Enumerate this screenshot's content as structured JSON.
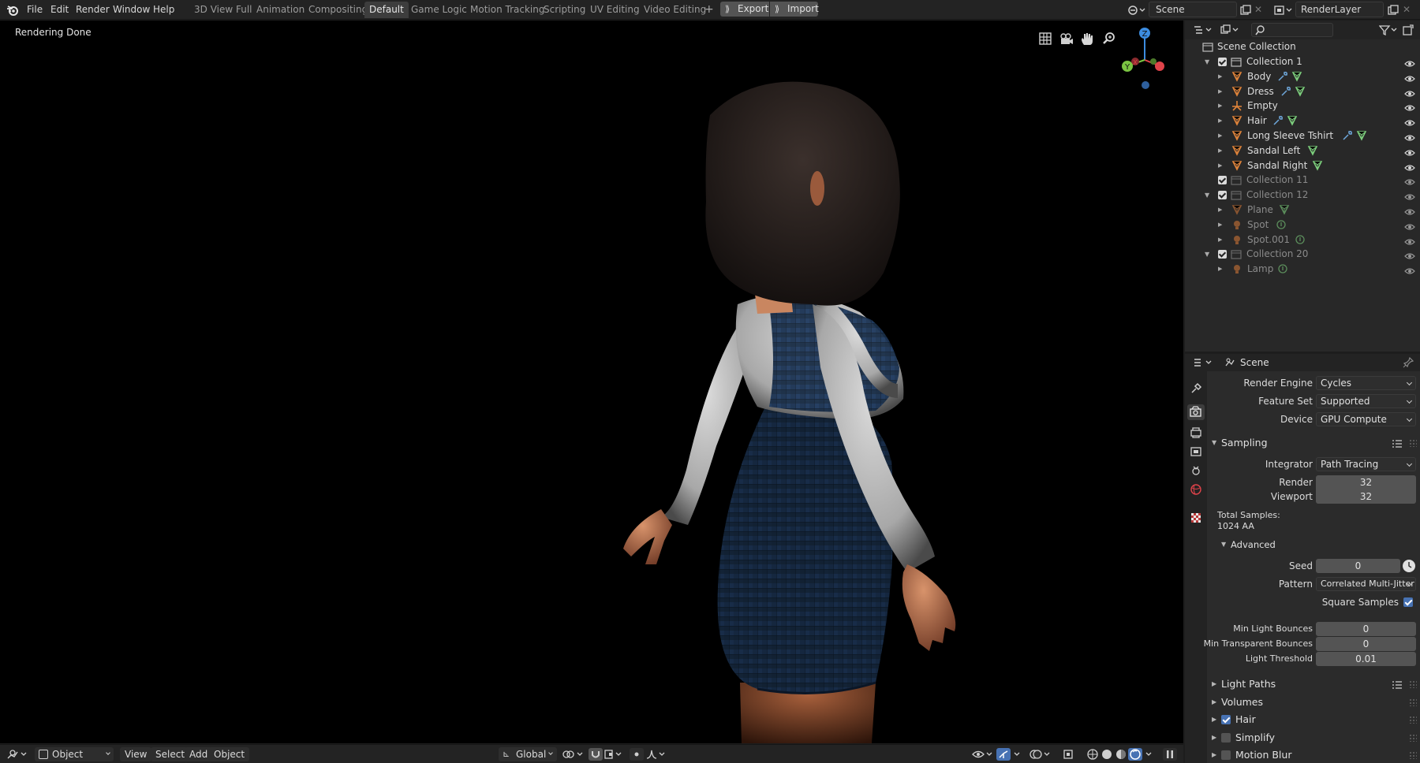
{
  "topbar": {
    "menus": [
      "File",
      "Edit",
      "Render",
      "Window",
      "Help"
    ],
    "workspaces": [
      "3D View Full",
      "Animation",
      "Compositing",
      "Default",
      "Game Logic",
      "Motion Tracking",
      "Scripting",
      "UV Editing",
      "Video Editing"
    ],
    "active_workspace": "Default",
    "add_tab": "+",
    "export_label": "Export",
    "import_label": "Import",
    "scene_name": "Scene",
    "render_layer": "RenderLayer"
  },
  "viewport": {
    "status": "Rendering Done",
    "gizmo": {
      "x": "X",
      "y": "Y",
      "z": "Z"
    }
  },
  "bottombar": {
    "mode": "Object Mode",
    "menus": [
      "View",
      "Select",
      "Add",
      "Object"
    ],
    "orientation": "Global"
  },
  "outliner": {
    "root": "Scene Collection",
    "rows": [
      {
        "label": "Collection 1",
        "level": 1,
        "kind": "collection",
        "dim": false,
        "expanded": true
      },
      {
        "label": "Body",
        "level": 2,
        "kind": "mesh",
        "dim": false,
        "icons": [
          "wrench",
          "mesh"
        ]
      },
      {
        "label": "Dress",
        "level": 2,
        "kind": "mesh",
        "dim": false,
        "icons": [
          "wrench",
          "mesh"
        ]
      },
      {
        "label": "Empty",
        "level": 2,
        "kind": "empty",
        "dim": false,
        "icons": []
      },
      {
        "label": "Hair",
        "level": 2,
        "kind": "mesh",
        "dim": false,
        "icons": [
          "wrench",
          "mesh"
        ]
      },
      {
        "label": "Long Sleeve Tshirt",
        "level": 2,
        "kind": "mesh",
        "dim": false,
        "icons": [
          "wrench",
          "mesh"
        ]
      },
      {
        "label": "Sandal Left",
        "level": 2,
        "kind": "mesh",
        "dim": false,
        "icons": [
          "mesh"
        ]
      },
      {
        "label": "Sandal Right",
        "level": 2,
        "kind": "mesh",
        "dim": false,
        "icons": [
          "mesh"
        ]
      },
      {
        "label": "Collection 11",
        "level": 1,
        "kind": "collection",
        "dim": true,
        "expanded": false
      },
      {
        "label": "Collection 12",
        "level": 1,
        "kind": "collection",
        "dim": true,
        "expanded": true
      },
      {
        "label": "Plane",
        "level": 2,
        "kind": "mesh",
        "dim": true,
        "icons": [
          "mesh"
        ]
      },
      {
        "label": "Spot",
        "level": 2,
        "kind": "light",
        "dim": true,
        "icons": [
          "light-data"
        ]
      },
      {
        "label": "Spot.001",
        "level": 2,
        "kind": "light",
        "dim": true,
        "icons": [
          "light-data"
        ]
      },
      {
        "label": "Collection 20",
        "level": 1,
        "kind": "collection",
        "dim": true,
        "expanded": true
      },
      {
        "label": "Lamp",
        "level": 2,
        "kind": "light",
        "dim": true,
        "icons": [
          "light-data"
        ]
      }
    ]
  },
  "properties": {
    "context": "Scene",
    "render_engine": {
      "label": "Render Engine",
      "value": "Cycles"
    },
    "feature_set": {
      "label": "Feature Set",
      "value": "Supported"
    },
    "device": {
      "label": "Device",
      "value": "GPU Compute"
    },
    "sampling": {
      "title": "Sampling",
      "integrator": {
        "label": "Integrator",
        "value": "Path Tracing"
      },
      "render": {
        "label": "Render",
        "value": "32"
      },
      "viewport": {
        "label": "Viewport",
        "value": "32"
      },
      "total_label": "Total Samples:",
      "total_value": "1024 AA",
      "advanced": {
        "title": "Advanced",
        "seed": {
          "label": "Seed",
          "value": "0"
        },
        "pattern": {
          "label": "Pattern",
          "value": "Correlated Multi-Jitter"
        },
        "square_samples": {
          "label": "Square Samples",
          "checked": true
        },
        "min_light_bounces": {
          "label": "Min Light Bounces",
          "value": "0"
        },
        "min_transparent_bounces": {
          "label": "Min Transparent Bounces",
          "value": "0"
        },
        "light_threshold": {
          "label": "Light Threshold",
          "value": "0.01"
        }
      }
    },
    "panels": [
      {
        "label": "Light Paths",
        "checkbox": false
      },
      {
        "label": "Volumes",
        "checkbox": false
      },
      {
        "label": "Hair",
        "checkbox": true,
        "checked": true
      },
      {
        "label": "Simplify",
        "checkbox": true,
        "checked": false
      },
      {
        "label": "Motion Blur",
        "checkbox": true,
        "checked": false
      }
    ]
  },
  "colors": {
    "accent_blue": "#4772b3",
    "mesh_orange": "#e0843a",
    "modifier_blue": "#6fa8dc",
    "mesh_data_green": "#7ed17e",
    "axis_x": "#e0434a",
    "axis_y": "#7bc442",
    "axis_z": "#3c8ce0"
  }
}
